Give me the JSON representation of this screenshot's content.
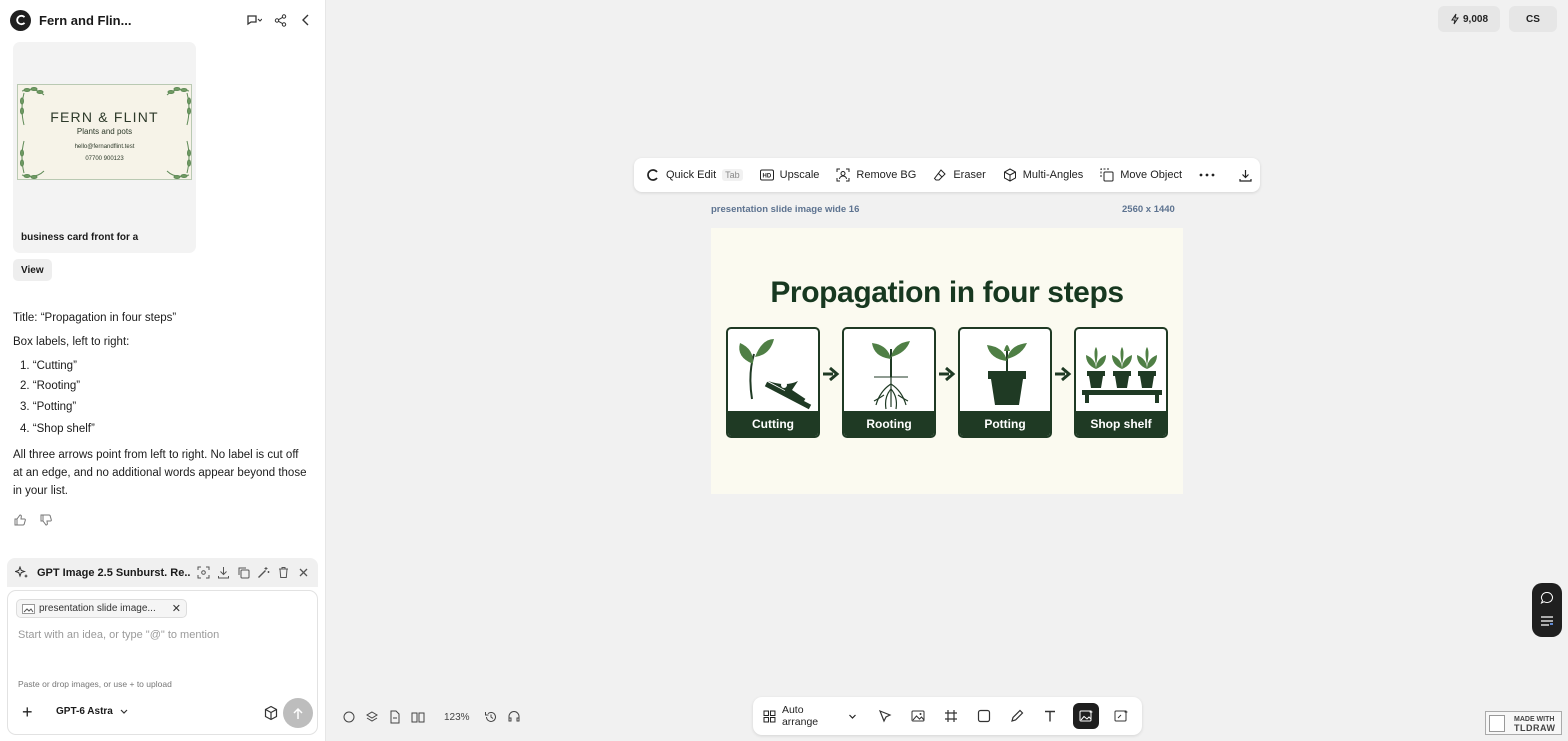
{
  "sidebar": {
    "project_title": "Fern and Flin...",
    "card": {
      "bc_title": "FERN & FLINT",
      "bc_subtitle": "Plants and pots",
      "bc_email": "hello@fernandflint.test",
      "bc_phone": "07700 900123",
      "caption": "business card front for a"
    },
    "view_label": "View",
    "message": {
      "title_line": "Title: “Propagation in four steps”",
      "box_intro": "Box labels, left to right:",
      "items": [
        "“Cutting”",
        "“Rooting”",
        "“Potting”",
        "“Shop shelf”"
      ],
      "item_numbers": [
        "1.",
        "2.",
        "3.",
        "4."
      ],
      "closing": "All three arrows point from left to right. No label is cut off at an edge, and no additional words appear beyond those in your list."
    },
    "generation": {
      "title": "GPT Image 2.5 Sunburst. Re..."
    },
    "composer": {
      "attachment_label": "presentation slide image...",
      "placeholder": "Start with an idea, or type \"@\" to mention",
      "hint": "Paste or drop images, or use + to upload",
      "model": "GPT-6 Astra"
    }
  },
  "header": {
    "credits": "9,008",
    "avatar": "CS"
  },
  "image_toolbar": {
    "quick_edit": "Quick Edit",
    "quick_edit_key": "Tab",
    "upscale": "Upscale",
    "remove_bg": "Remove BG",
    "eraser": "Eraser",
    "multi_angles": "Multi-Angles",
    "move_object": "Move Object"
  },
  "canvas": {
    "image_name": "presentation slide image wide 16",
    "image_dimensions": "2560 x 1440",
    "slide": {
      "title": "Propagation in four steps",
      "steps": [
        "Cutting",
        "Rooting",
        "Potting",
        "Shop shelf"
      ]
    }
  },
  "bottom_toolbar": {
    "auto_arrange": "Auto arrange"
  },
  "zoom": "123%",
  "branding": {
    "line1": "MADE WITH",
    "line2": "TLDRAW"
  },
  "colors": {
    "slide_green": "#1f3a24",
    "leaf_green": "#4f7f45",
    "meta_blue": "#5d7390"
  }
}
